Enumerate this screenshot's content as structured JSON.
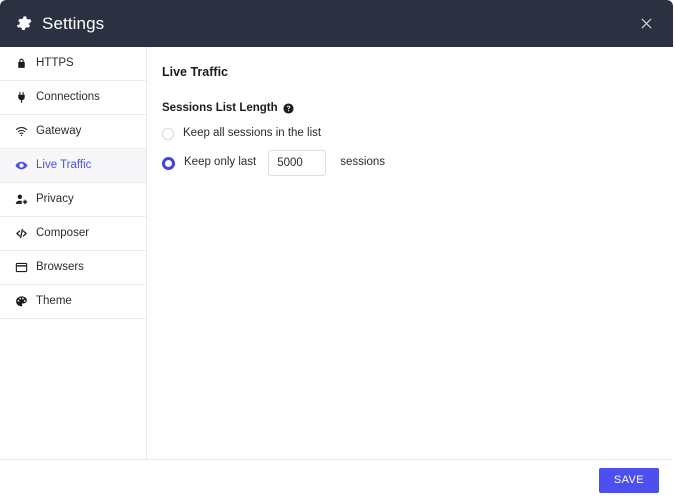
{
  "window": {
    "title": "Settings",
    "gear_icon": "gear-icon",
    "close_icon": "close-icon",
    "header_bg": "#2c3142"
  },
  "sidebar": {
    "items": [
      {
        "label": "HTTPS",
        "icon": "lock-icon",
        "active": false
      },
      {
        "label": "Connections",
        "icon": "plug-icon",
        "active": false
      },
      {
        "label": "Gateway",
        "icon": "wifi-icon",
        "active": false
      },
      {
        "label": "Live Traffic",
        "icon": "eye-icon",
        "active": true
      },
      {
        "label": "Privacy",
        "icon": "user-gear-icon",
        "active": false
      },
      {
        "label": "Composer",
        "icon": "code-icon",
        "active": false
      },
      {
        "label": "Browsers",
        "icon": "window-icon",
        "active": false
      },
      {
        "label": "Theme",
        "icon": "palette-icon",
        "active": false
      }
    ],
    "active_color": "#4b4fe0",
    "active_bg": "#f7f7fa"
  },
  "main": {
    "section_title": "Live Traffic",
    "field": {
      "label": "Sessions List Length",
      "help_icon": "help-circle-icon",
      "options": [
        {
          "label": "Keep all sessions in the list",
          "selected": false
        },
        {
          "label": "Keep only last",
          "selected": true
        }
      ],
      "input_value": "5000",
      "input_placeholder": "",
      "unit_label": "sessions"
    }
  },
  "footer": {
    "save_label": "SAVE",
    "save_color": "#4b50ee"
  }
}
